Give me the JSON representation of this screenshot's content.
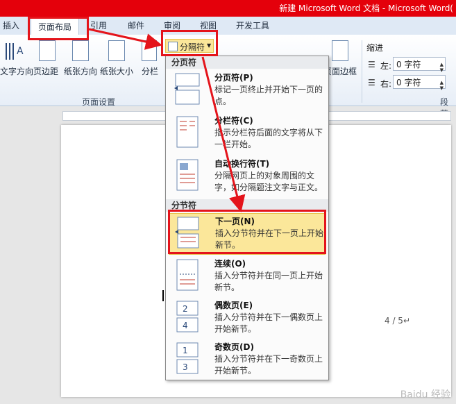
{
  "title": "新建 Microsoft Word 文档 - Microsoft Word(",
  "tabs": {
    "insert": "插入",
    "layout": "页面布局",
    "references": "引用",
    "mailings": "邮件",
    "review": "审阅",
    "view": "视图",
    "developer": "开发工具"
  },
  "ribbon": {
    "text_direction": "文字方向",
    "margins": "页边距",
    "orientation": "纸张方向",
    "size": "纸张大小",
    "columns": "分栏",
    "breaks": "分隔符",
    "page_borders": "页面边框",
    "page_setup_group": "页面设置",
    "indent_title": "缩进",
    "indent_left_label": "左:",
    "indent_left_value": "0 字符",
    "indent_right_label": "右:",
    "indent_right_value": "0 字符",
    "paragraph_group": "段落"
  },
  "menu": {
    "page_breaks_header": "分页符",
    "section_breaks_header": "分节符",
    "items": [
      {
        "title": "分页符(P)",
        "desc": "标记一页终止并开始下一页的点。"
      },
      {
        "title": "分栏符(C)",
        "desc": "指示分栏符后面的文字将从下一栏开始。"
      },
      {
        "title": "自动换行符(T)",
        "desc": "分隔网页上的对象周围的文字，如分隔题注文字与正文。"
      },
      {
        "title": "下一页(N)",
        "desc": "插入分节符并在下一页上开始新节。"
      },
      {
        "title": "连续(O)",
        "desc": "插入分节符并在同一页上开始新节。"
      },
      {
        "title": "偶数页(E)",
        "desc": "插入分节符并在下一偶数页上开始新节。"
      },
      {
        "title": "奇数页(D)",
        "desc": "插入分节符并在下一奇数页上开始新节。"
      }
    ],
    "even_icon_number_a": "2",
    "even_icon_number_b": "4",
    "odd_icon_number_a": "1",
    "odd_icon_number_b": "3"
  },
  "document": {
    "page_marker": "4 / 5↵"
  },
  "watermark": "Baidu 经验",
  "colors": {
    "titlebar": "#e4000b",
    "annotation": "#e4141b",
    "highlight": "#fbe79a"
  }
}
